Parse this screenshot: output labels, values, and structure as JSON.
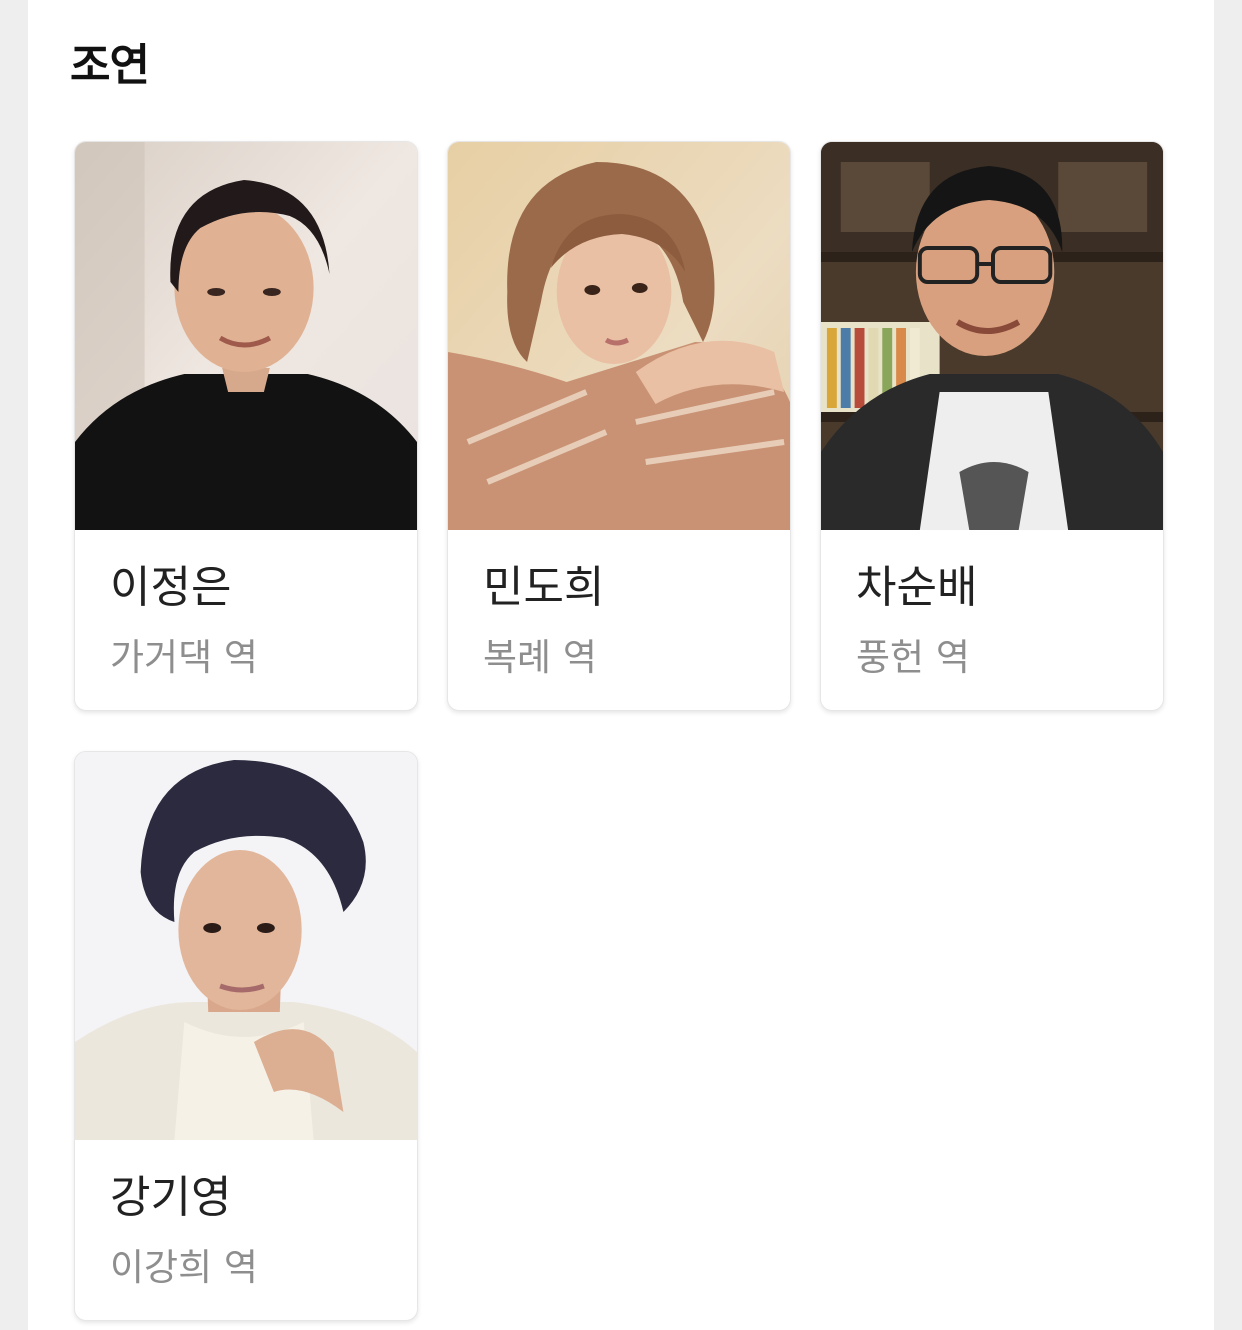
{
  "section": {
    "title": "조연"
  },
  "cast": [
    {
      "name": "이정은",
      "role": "가거댁 역",
      "photo_alt": "이정은 프로필 사진"
    },
    {
      "name": "민도희",
      "role": "복례 역",
      "photo_alt": "민도희 프로필 사진"
    },
    {
      "name": "차순배",
      "role": "풍헌 역",
      "photo_alt": "차순배 프로필 사진"
    },
    {
      "name": "강기영",
      "role": "이강희 역",
      "photo_alt": "강기영 프로필 사진"
    }
  ]
}
